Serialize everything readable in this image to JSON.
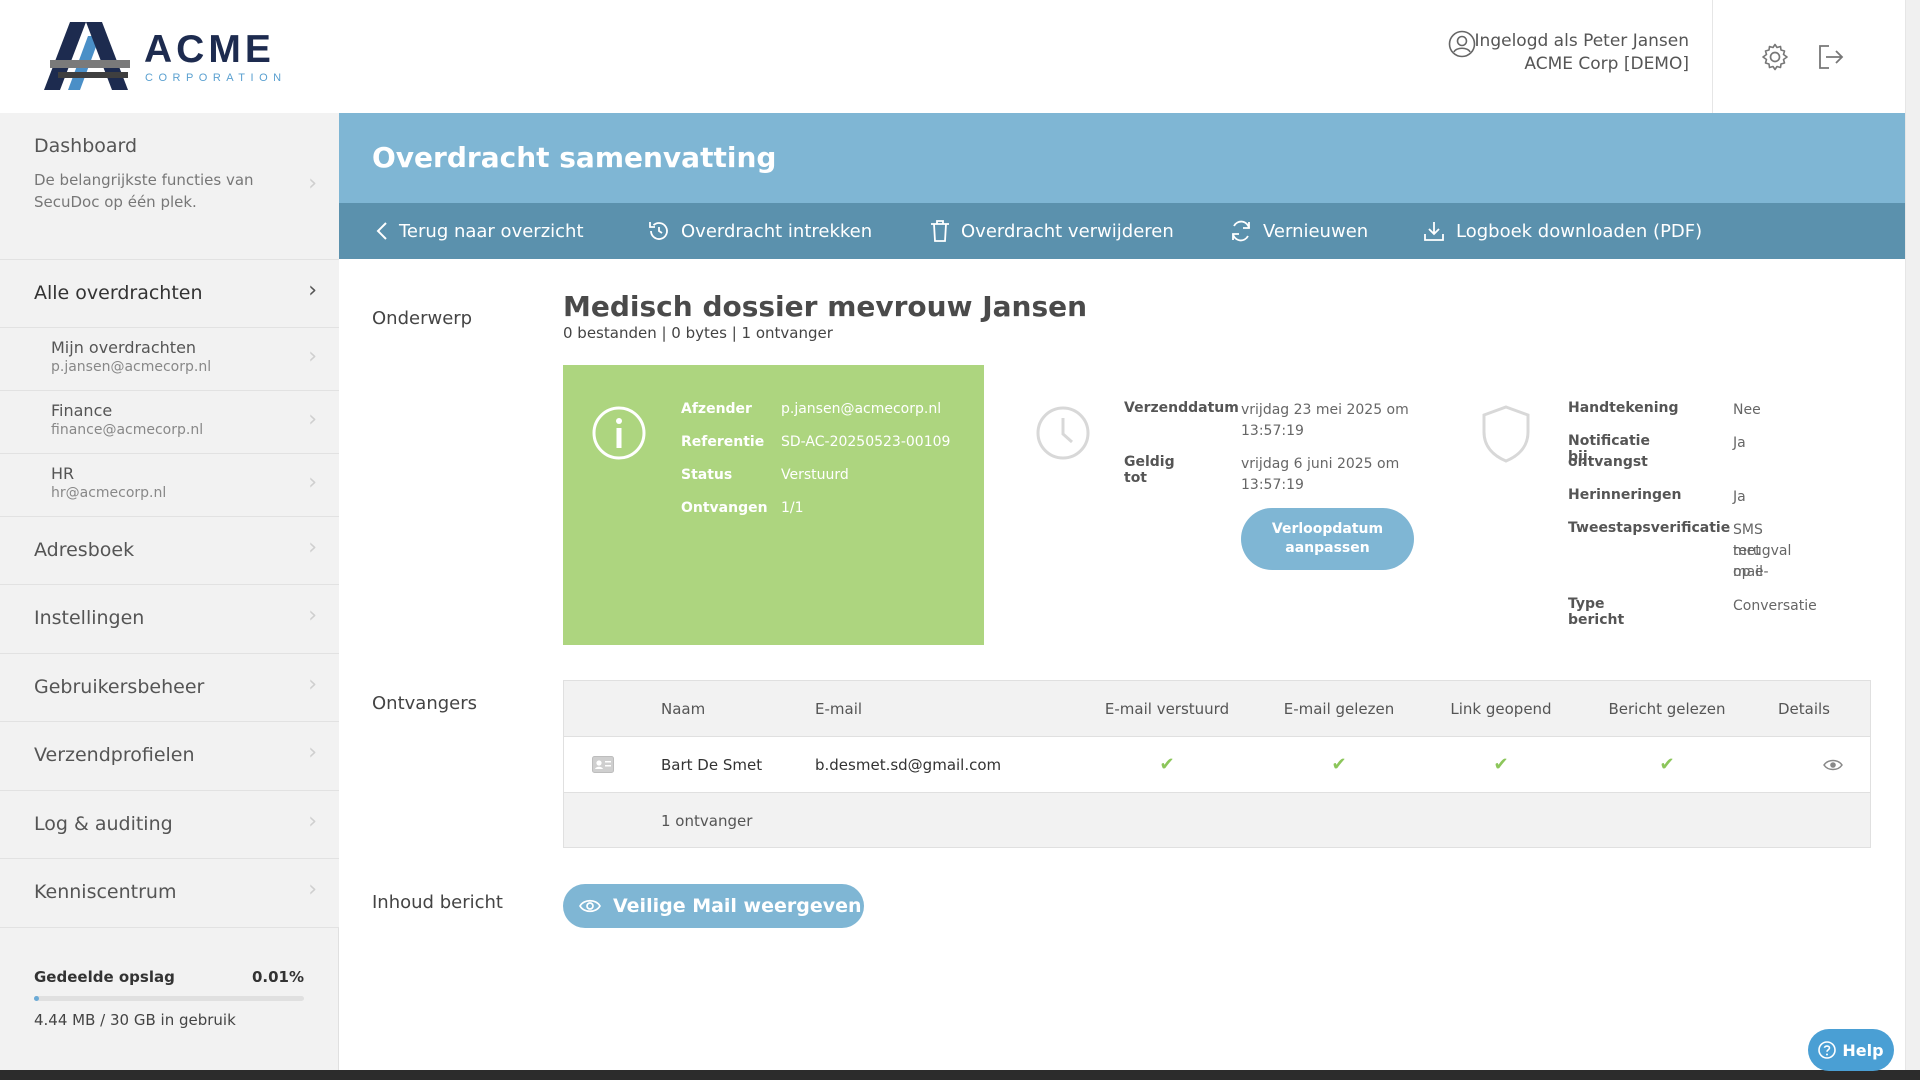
{
  "brand": {
    "name": "ACME",
    "subtitle": "CORPORATION"
  },
  "header": {
    "user_line": "Ingelogd als Peter Jansen",
    "org_line": "ACME Corp [DEMO]"
  },
  "sidebar": {
    "dashboard": {
      "label": "Dashboard",
      "desc": "De belangrijkste functies van SecuDoc op één plek."
    },
    "all_transfers": "Alle overdrachten",
    "sub_items": [
      {
        "label": "Mijn overdrachten",
        "email": "p.jansen@acmecorp.nl"
      },
      {
        "label": "Finance",
        "email": "finance@acmecorp.nl"
      },
      {
        "label": "HR",
        "email": "hr@acmecorp.nl"
      }
    ],
    "items": [
      "Adresboek",
      "Instellingen",
      "Gebruikersbeheer",
      "Verzendprofielen",
      "Log & auditing",
      "Kenniscentrum"
    ],
    "storage": {
      "label": "Gedeelde opslag",
      "percent": "0.01%",
      "fill_fraction": 0.0001,
      "used": "4.44 MB / 30 GB in gebruik"
    }
  },
  "page": {
    "title": "Overdracht samenvatting",
    "toolbar": {
      "back": "Terug naar overzicht",
      "revoke": "Overdracht intrekken",
      "delete": "Overdracht verwijderen",
      "renew": "Vernieuwen",
      "download_log": "Logboek downloaden (PDF)"
    },
    "labels": {
      "subject": "Onderwerp",
      "recipients": "Ontvangers",
      "content": "Inhoud bericht"
    },
    "subject": "Medisch dossier mevrouw Jansen",
    "subject_meta": "0 bestanden | 0 bytes | 1 ontvanger",
    "info": {
      "sender_k": "Afzender",
      "sender_v": "p.jansen@acmecorp.nl",
      "ref_k": "Referentie",
      "ref_v": "SD-AC-20250523-00109",
      "status_k": "Status",
      "status_v": "Verstuurd",
      "received_k": "Ontvangen",
      "received_v": "1/1"
    },
    "dates": {
      "sent_k": "Verzenddatum",
      "sent_v1": "vrijdag 23 mei 2025 om",
      "sent_v2": "13:57:19",
      "valid_k": "Geldig tot",
      "valid_v1": "vrijdag 6 juni 2025 om",
      "valid_v2": "13:57:19",
      "expiry_btn_1": "Verloopdatum",
      "expiry_btn_2": "aanpassen"
    },
    "security": {
      "sig_k": "Handtekening",
      "sig_v": "Nee",
      "notif_k1": "Notificatie bij",
      "notif_k2": "ontvangst",
      "notif_v": "Ja",
      "remind_k": "Herinneringen",
      "remind_v": "Ja",
      "twofa_k": "Tweestapsverificatie",
      "twofa_v1": "SMS met",
      "twofa_v2": "terugval op e-",
      "twofa_v3": "mail",
      "type_k": "Type bericht",
      "type_v": "Conversatie"
    },
    "table": {
      "headers": [
        "Naam",
        "E-mail",
        "E-mail verstuurd",
        "E-mail gelezen",
        "Link geopend",
        "Bericht gelezen",
        "Details"
      ],
      "rows": [
        {
          "name": "Bart De Smet",
          "email": "b.desmet.sd@gmail.com"
        }
      ],
      "footer": "1 ontvanger"
    },
    "view_mail_btn": "Veilige Mail weergeven"
  },
  "help_btn": "Help",
  "colors": {
    "accent": "#7fb6d4",
    "toolbar": "#5b91ad",
    "success": "#add57f",
    "check": "#8cc65b"
  }
}
